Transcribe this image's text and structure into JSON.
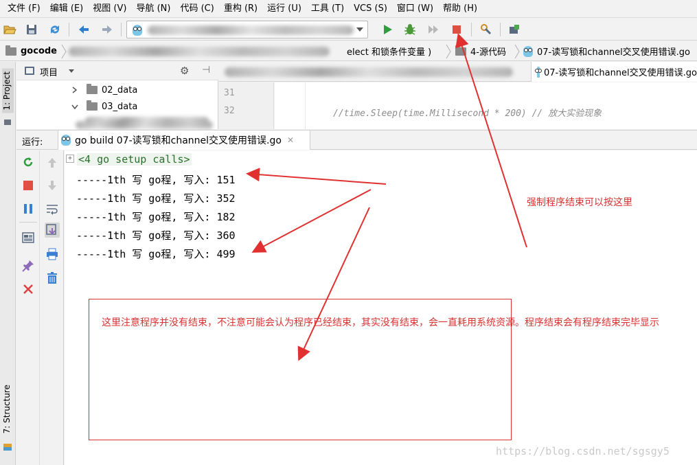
{
  "menu": [
    "文件 (F)",
    "编辑 (E)",
    "视图 (V)",
    "导航 (N)",
    "代码 (C)",
    "重构 (R)",
    "运行 (U)",
    "工具 (T)",
    "VCS (S)",
    "窗口 (W)",
    "帮助 (H)"
  ],
  "breadcrumb": {
    "root": "gocode",
    "partial": "elect 和锁条件变量 )",
    "folder": "4-源代码",
    "file": "07-读写锁和channel交叉使用错误.go"
  },
  "side_tabs": {
    "project": "1: Project",
    "structure": "7: Structure"
  },
  "project": {
    "title": "项目",
    "items": [
      {
        "name": "02_data",
        "expanded": false
      },
      {
        "name": "03_data",
        "expanded": true
      }
    ]
  },
  "editor": {
    "active_tab": "07-读写锁和channel交叉使用错误.go",
    "line_numbers": [
      "31",
      "32"
    ],
    "code_line": "//time.Sleep(time.Millisecond * 200)        // 放大实验现象"
  },
  "run": {
    "label": "运行:",
    "tab_title": "go build 07-读写锁和channel交叉使用错误.go",
    "header": "<4 go setup calls>",
    "lines": [
      "-----1th 写 go程, 写入: 151",
      "-----1th 写 go程, 写入: 352",
      "-----1th 写 go程, 写入: 182",
      "-----1th 写 go程, 写入: 360",
      "-----1th 写 go程, 写入: 499"
    ]
  },
  "annotations": {
    "force_stop": "强制程序结束可以按这里",
    "note": "这里注意程序并没有结束，不注意可能会认为程序已经结束，其实没有结束，会一直耗用系统资源。程序结束会有程序结束完毕显示"
  },
  "watermark": "https://blog.csdn.net/sgsgy5",
  "colors": {
    "accent_red": "#d83232",
    "run_green": "#2e9e3e",
    "stop_red": "#e05040",
    "console_header_green": "#2d6e2d"
  }
}
